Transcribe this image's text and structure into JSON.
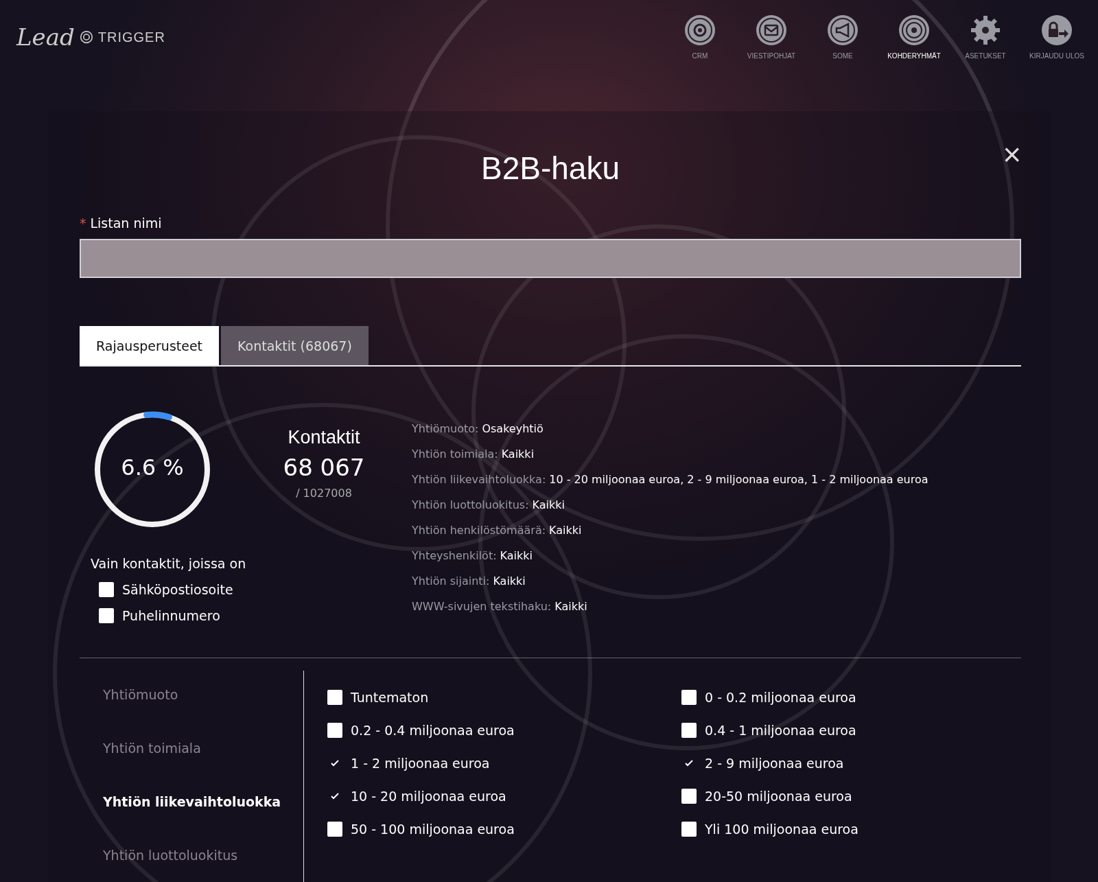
{
  "logo": {
    "script": "Lead",
    "word": "TRIGGER"
  },
  "nav": [
    {
      "label": "CRM",
      "kind": "crm",
      "selected": false
    },
    {
      "label": "VIESTIPOHJAT",
      "kind": "mail",
      "selected": false
    },
    {
      "label": "SOME",
      "kind": "megaphone",
      "selected": false
    },
    {
      "label": "KOHDERYHMÄT",
      "kind": "target",
      "selected": true
    },
    {
      "label": "ASETUKSET",
      "kind": "gear",
      "selected": false
    },
    {
      "label": "KIRJAUDU ULOS",
      "kind": "logout",
      "selected": false
    }
  ],
  "dialog": {
    "title": "B2B-haku",
    "close": "×",
    "name_field": {
      "required_mark": "*",
      "label": "Listan nimi"
    },
    "tabs": [
      {
        "label": "Rajausperusteet",
        "selected": true
      },
      {
        "label": "Kontaktit (68067)",
        "selected": false
      }
    ],
    "progress": {
      "level": 0.066,
      "reading": "6.6 %"
    },
    "contacts": {
      "title": "Kontaktit",
      "count": "68 067",
      "total": "/ 1027008"
    },
    "only_with": {
      "label": "Vain kontaktit, joissa on",
      "options": [
        {
          "label": "Sähköpostiosoite",
          "checked": false
        },
        {
          "label": "Puhelinnumero",
          "checked": false
        }
      ]
    },
    "summary": [
      {
        "label": "Yhtiömuoto:",
        "value": "Osakeyhtiö"
      },
      {
        "label": "Yhtiön toimiala:",
        "value": "Kaikki"
      },
      {
        "label": "Yhtiön liikevaihtoluokka:",
        "value": "10 - 20 miljoonaa euroa, 2 - 9 miljoonaa euroa, 1 - 2 miljoonaa euroa"
      },
      {
        "label": "Yhtiön luottoluokitus:",
        "value": "Kaikki"
      },
      {
        "label": "Yhtiön henkilöstömäärä:",
        "value": "Kaikki"
      },
      {
        "label": "Yhteyshenkilöt:",
        "value": "Kaikki"
      },
      {
        "label": "Yhtiön sijainti:",
        "value": "Kaikki"
      },
      {
        "label": "WWW-sivujen tekstihaku:",
        "value": "Kaikki"
      }
    ],
    "categories": [
      {
        "label": "Yhtiömuoto",
        "selected": false
      },
      {
        "label": "Yhtiön toimiala",
        "selected": false
      },
      {
        "label": "Yhtiön liikevaihtoluokka",
        "selected": true
      },
      {
        "label": "Yhtiön luottoluokitus",
        "selected": false
      }
    ],
    "options": [
      {
        "label": "Tuntematon",
        "checked": false
      },
      {
        "label": "0 - 0.2 miljoonaa euroa",
        "checked": false
      },
      {
        "label": "0.2 - 0.4 miljoonaa euroa",
        "checked": false
      },
      {
        "label": "0.4 - 1 miljoonaa euroa",
        "checked": false
      },
      {
        "label": "1 - 2 miljoonaa euroa",
        "checked": true
      },
      {
        "label": "2 - 9 miljoonaa euroa",
        "checked": true
      },
      {
        "label": "10 - 20 miljoonaa euroa",
        "checked": true
      },
      {
        "label": "20-50 miljoonaa euroa",
        "checked": false
      },
      {
        "label": "50 - 100 miljoonaa euroa",
        "checked": false
      },
      {
        "label": "Yli 100 miljoonaa euroa",
        "checked": false
      }
    ]
  }
}
